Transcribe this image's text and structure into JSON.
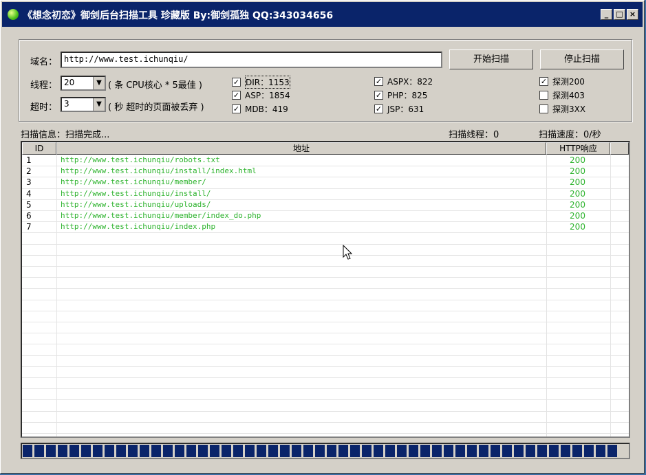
{
  "window": {
    "title": "《想念初恋》御剑后台扫描工具 珍藏版 By:御剑孤独 QQ:343034656",
    "buttons": {
      "minimize": "_",
      "maximize": "□",
      "close": "×"
    }
  },
  "form": {
    "domain_label": "域名：",
    "domain_value": "http://www.test.ichunqiu/",
    "start_button": "开始扫描",
    "stop_button": "停止扫描",
    "threads_label": "线程：",
    "threads_value": "20",
    "threads_hint": "( 条 CPU核心 * 5最佳 )",
    "timeout_label": "超时：",
    "timeout_value": "3",
    "timeout_hint": "( 秒 超时的页面被丢弃 )"
  },
  "checks": [
    {
      "label": "DIR：1153",
      "checked": true
    },
    {
      "label": "ASP：1854",
      "checked": true
    },
    {
      "label": "MDB：419",
      "checked": true
    },
    {
      "label": "ASPX：822",
      "checked": true
    },
    {
      "label": "PHP：825",
      "checked": true
    },
    {
      "label": "JSP：631",
      "checked": true
    },
    {
      "label": "探测200",
      "checked": true
    },
    {
      "label": "探测403",
      "checked": false
    },
    {
      "label": "探测3XX",
      "checked": false
    }
  ],
  "status": {
    "info": "扫描信息：扫描完成...",
    "threads": "扫描线程：0",
    "speed": "扫描速度：0/秒"
  },
  "table": {
    "headers": [
      "ID",
      "地址",
      "HTTP响应"
    ],
    "rows": [
      [
        "1",
        "http://www.test.ichunqiu/robots.txt",
        "200"
      ],
      [
        "2",
        "http://www.test.ichunqiu/install/index.html",
        "200"
      ],
      [
        "3",
        "http://www.test.ichunqiu/member/",
        "200"
      ],
      [
        "4",
        "http://www.test.ichunqiu/install/",
        "200"
      ],
      [
        "5",
        "http://www.test.ichunqiu/uploads/",
        "200"
      ],
      [
        "6",
        "http://www.test.ichunqiu/member/index_do.php",
        "200"
      ],
      [
        "7",
        "http://www.test.ichunqiu/index.php",
        "200"
      ]
    ]
  },
  "progress": {
    "fraction": 1.0
  },
  "colors": {
    "title_bg": "#0a246a",
    "ok_text": "#2db32d",
    "face": "#d4d0c8"
  }
}
